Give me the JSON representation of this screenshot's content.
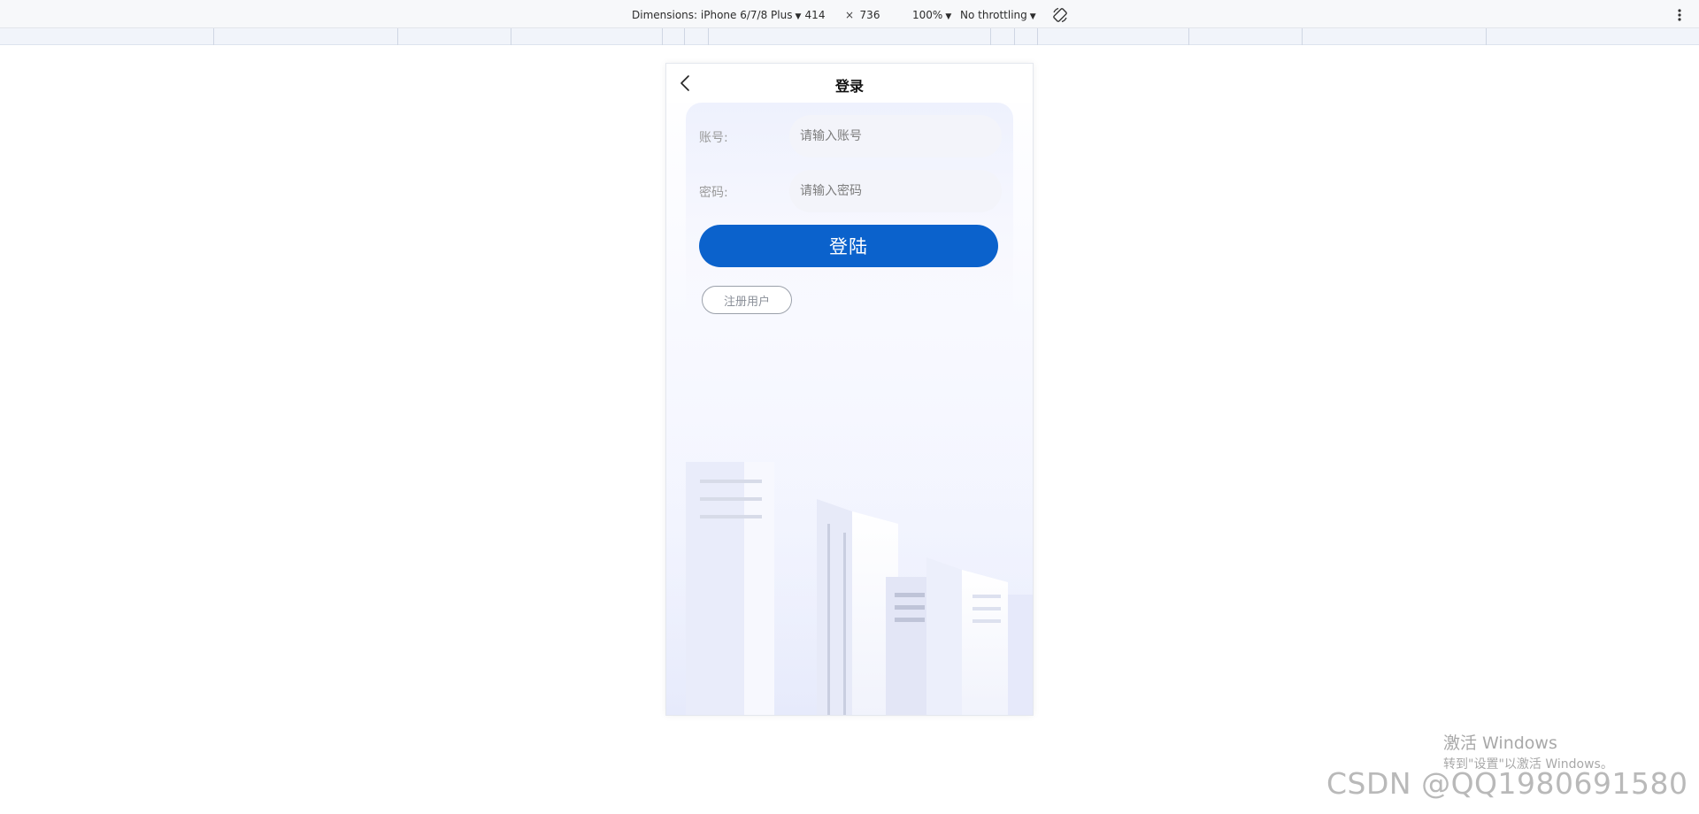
{
  "devtools": {
    "dimensions_label": "Dimensions: iPhone 6/7/8 Plus",
    "width_value": "414",
    "times_sign": "×",
    "height_value": "736",
    "zoom_label": "100%",
    "throttle_label": "No throttling",
    "icons": [
      "caret-down-icon",
      "rotate-icon",
      "kebab-menu-icon"
    ]
  },
  "app": {
    "title": "登录",
    "back_icon": "chevron-left-icon",
    "form": {
      "account_label": "账号:",
      "account_placeholder": "请输入账号",
      "account_value": "",
      "password_label": "密码:",
      "password_placeholder": "请输入密码",
      "password_value": ""
    },
    "login_button": "登陆",
    "register_button": "注册用户",
    "colors": {
      "primary": "#0b62cc",
      "label": "#9a9a9a",
      "background_tint": "#eef1fe"
    }
  },
  "watermarks": {
    "windows_line1": "激活 Windows",
    "windows_line2": "转到\"设置\"以激活 Windows。",
    "csdn": "CSDN @QQ1980691580"
  }
}
